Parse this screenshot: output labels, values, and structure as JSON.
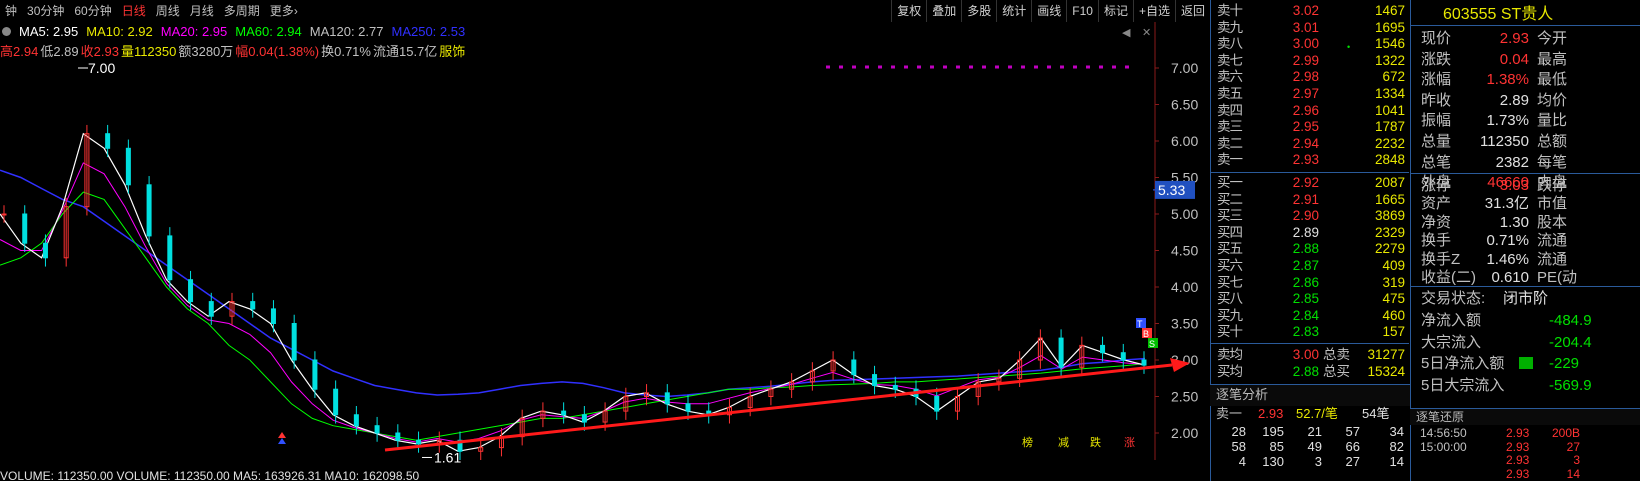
{
  "toolbar": {
    "periods": [
      "钟",
      "30分钟",
      "60分钟",
      "日线",
      "周线",
      "月线",
      "多周期",
      "更多"
    ],
    "more_arrow": "›",
    "buttons": [
      "复权",
      "叠加",
      "多股",
      "统计",
      "画线",
      "F10",
      "标记",
      "+自选",
      "返回"
    ]
  },
  "ma_line": {
    "ma5": "MA5: 2.95",
    "ma10": "MA10: 2.92",
    "ma20": "MA20: 2.95",
    "ma60": "MA60: 2.94",
    "ma120": "MA120: 2.77",
    "ma250": "MA250: 2.53"
  },
  "info_line": {
    "high": "高2.94",
    "low": "低2.89",
    "close": "收2.93",
    "volume": "量112350",
    "amount": "额3280万",
    "change": "幅0.04(1.38%)",
    "turnover": "换0.71%",
    "float_cap": "流通15.7亿",
    "sector": "服饰"
  },
  "chart_controls": [
    "◀",
    "✕"
  ],
  "chart_data": {
    "type": "line",
    "title": "",
    "y_ticks": [
      "7.00",
      "6.50",
      "6.00",
      "5.50",
      "5.00",
      "4.50",
      "4.00",
      "3.50",
      "3.00",
      "2.50",
      "2.00"
    ],
    "ylim": [
      2.0,
      7.0
    ],
    "high_label": "7.00",
    "low_label": "1.61",
    "cursor_price": "5.33",
    "price_trend": [
      5.0,
      4.6,
      4.4,
      5.1,
      6.1,
      5.9,
      5.4,
      4.7,
      4.1,
      3.8,
      3.6,
      3.8,
      3.7,
      3.5,
      3.0,
      2.6,
      2.25,
      2.1,
      2.0,
      1.9,
      1.85,
      1.9,
      1.75,
      1.8,
      1.95,
      2.2,
      2.3,
      2.25,
      2.15,
      2.3,
      2.5,
      2.55,
      2.4,
      2.3,
      2.25,
      2.35,
      2.5,
      2.6,
      2.7,
      2.85,
      3.0,
      2.8,
      2.65,
      2.6,
      2.5,
      2.3,
      2.5,
      2.7,
      2.75,
      3.0,
      3.3,
      2.9,
      3.2,
      3.1,
      3.0,
      2.93
    ],
    "ma250_trend": [
      5.6,
      5.5,
      5.35,
      5.2,
      5.1,
      4.9,
      4.7,
      4.5,
      4.3,
      4.1,
      3.9,
      3.7,
      3.5,
      3.3,
      3.15,
      3.0,
      2.85,
      2.75,
      2.65,
      2.6,
      2.55,
      2.52,
      2.53,
      2.55,
      2.6,
      2.65,
      2.68,
      2.7,
      2.68,
      2.62,
      2.55,
      2.52,
      2.5,
      2.52,
      2.55,
      2.6,
      2.62,
      2.64,
      2.67,
      2.7,
      2.72,
      2.73,
      2.74,
      2.75,
      2.76,
      2.77,
      2.78,
      2.8,
      2.82,
      2.84,
      2.86,
      2.9,
      2.95,
      2.97,
      3.0,
      3.02
    ],
    "ma20_trend": [
      4.3,
      4.4,
      4.6,
      5.0,
      5.3,
      5.2,
      4.8,
      4.4,
      4.0,
      3.7,
      3.5,
      3.2,
      3.0,
      2.7,
      2.4,
      2.2,
      2.1,
      2.05,
      2.0,
      1.95,
      1.9,
      1.95,
      2.0,
      2.05,
      2.1,
      2.15,
      2.2,
      2.2,
      2.25,
      2.3,
      2.35,
      2.4,
      2.45,
      2.5,
      2.55,
      2.6,
      2.6,
      2.62,
      2.63,
      2.65,
      2.66,
      2.67,
      2.68,
      2.7,
      2.7,
      2.72,
      2.74,
      2.76,
      2.78,
      2.8,
      2.82,
      2.85,
      2.88,
      2.9,
      2.92,
      2.95
    ],
    "signal_labels": [
      "T",
      "B",
      "S"
    ],
    "bottom_markers": [
      "榜",
      "减",
      "跌",
      "涨"
    ]
  },
  "volume_line": "VOLUME: 112350.00  VOLUME: 112350.00  MA5: 163926.31  MA10: 162098.50",
  "quote": {
    "sells": [
      {
        "label": "卖十",
        "price": "3.02",
        "vol": "1467",
        "color": "red"
      },
      {
        "label": "卖九",
        "price": "3.01",
        "vol": "1695",
        "color": "red"
      },
      {
        "label": "卖八",
        "price": "3.00",
        "vol": "1546",
        "color": "red"
      },
      {
        "label": "卖七",
        "price": "2.99",
        "vol": "1322",
        "color": "red"
      },
      {
        "label": "卖六",
        "price": "2.98",
        "vol": "672",
        "color": "red"
      },
      {
        "label": "卖五",
        "price": "2.97",
        "vol": "1334",
        "color": "red"
      },
      {
        "label": "卖四",
        "price": "2.96",
        "vol": "1041",
        "color": "red"
      },
      {
        "label": "卖三",
        "price": "2.95",
        "vol": "1787",
        "color": "red"
      },
      {
        "label": "卖二",
        "price": "2.94",
        "vol": "2232",
        "color": "red"
      },
      {
        "label": "卖一",
        "price": "2.93",
        "vol": "2848",
        "color": "red"
      }
    ],
    "buys": [
      {
        "label": "买一",
        "price": "2.92",
        "vol": "2087",
        "color": "red"
      },
      {
        "label": "买二",
        "price": "2.91",
        "vol": "1665",
        "color": "red"
      },
      {
        "label": "买三",
        "price": "2.90",
        "vol": "3869",
        "color": "red"
      },
      {
        "label": "买四",
        "price": "2.89",
        "vol": "2329",
        "color": "white"
      },
      {
        "label": "买五",
        "price": "2.88",
        "vol": "2279",
        "color": "green"
      },
      {
        "label": "买六",
        "price": "2.87",
        "vol": "409",
        "color": "green"
      },
      {
        "label": "买七",
        "price": "2.86",
        "vol": "319",
        "color": "green"
      },
      {
        "label": "买八",
        "price": "2.85",
        "vol": "475",
        "color": "green"
      },
      {
        "label": "买九",
        "price": "2.84",
        "vol": "460",
        "color": "green"
      },
      {
        "label": "买十",
        "price": "2.83",
        "vol": "157",
        "color": "green"
      }
    ],
    "sell_avg_label": "卖均",
    "sell_avg": "3.00",
    "total_sell_label": "总卖",
    "total_sell": "31277",
    "buy_avg_label": "买均",
    "buy_avg": "2.88",
    "total_buy_label": "总买",
    "total_buy": "15324"
  },
  "ticks": {
    "title": "逐笔分析",
    "header_label": "卖一",
    "header_price": "2.93",
    "header_ratio": "52.7/笔",
    "header_count": "54笔",
    "rows": [
      [
        "28",
        "195",
        "21",
        "57",
        "34"
      ],
      [
        "58",
        "85",
        "49",
        "66",
        "82"
      ],
      [
        "4",
        "130",
        "3",
        "27",
        "14"
      ]
    ]
  },
  "info": {
    "stock_title": "603555 ST贵人",
    "rows": [
      {
        "l1": "现价",
        "v1": "2.93",
        "c1": "red",
        "l2": "今开"
      },
      {
        "l1": "涨跌",
        "v1": "0.04",
        "c1": "red",
        "l2": "最高"
      },
      {
        "l1": "涨幅",
        "v1": "1.38%",
        "c1": "red",
        "l2": "最低"
      },
      {
        "l1": "昨收",
        "v1": "2.89",
        "c1": "white",
        "l2": "均价"
      },
      {
        "l1": "振幅",
        "v1": "1.73%",
        "c1": "white",
        "l2": "量比"
      },
      {
        "l1": "总量",
        "v1": "112350",
        "c1": "white",
        "l2": "总额"
      },
      {
        "l1": "总笔",
        "v1": "2382",
        "c1": "white",
        "l2": "每笔"
      },
      {
        "l1": "外盘",
        "v1": "46660",
        "c1": "red",
        "l2": "内盘"
      }
    ],
    "rows2": [
      {
        "l1": "涨停",
        "v1": "3.03",
        "c1": "red",
        "l2": "跌停"
      },
      {
        "l1": "资产",
        "v1": "31.3亿",
        "c1": "white",
        "l2": "市值"
      },
      {
        "l1": "净资",
        "v1": "1.30",
        "c1": "white",
        "l2": "股本"
      },
      {
        "l1": "换手",
        "v1": "0.71%",
        "c1": "white",
        "l2": "流通"
      },
      {
        "l1": "换手Z",
        "v1": "1.46%",
        "c1": "white",
        "l2": "流通"
      },
      {
        "l1": "收益(二)",
        "v1": "0.610",
        "c1": "white",
        "l2": "PE(动"
      }
    ],
    "trade_status_label": "交易状态:",
    "trade_status": "闭市阶",
    "flows": [
      {
        "label": "净流入额",
        "value": "-484.9",
        "color": "green"
      },
      {
        "label": "大宗流入",
        "value": "-204.4",
        "color": "green"
      },
      {
        "label": "5日净流入额",
        "value": "-229",
        "color": "green"
      },
      {
        "label": "5日大宗流入",
        "value": "-569.9",
        "color": "green"
      }
    ]
  },
  "deals": {
    "title": "逐笔还原",
    "rows": [
      {
        "time": "14:56:50",
        "price": "2.93",
        "vol": "200B"
      },
      {
        "time": "15:00:00",
        "price": "2.93",
        "vol": "27"
      },
      {
        "time": "",
        "price": "2.93",
        "vol": "3"
      },
      {
        "time": "",
        "price": "2.93",
        "vol": "14"
      }
    ]
  },
  "colors": {
    "up": "#ff3333",
    "down": "#00e000",
    "neutral": "#e0e0e0",
    "volume": "#e8e800",
    "ma5": "#ffffff",
    "ma10": "#e8e800",
    "ma20": "#ff00ff",
    "ma60": "#00ff00",
    "ma120": "#c0c0c0",
    "ma250": "#3030ff",
    "trendline": "#ff1a1a"
  }
}
